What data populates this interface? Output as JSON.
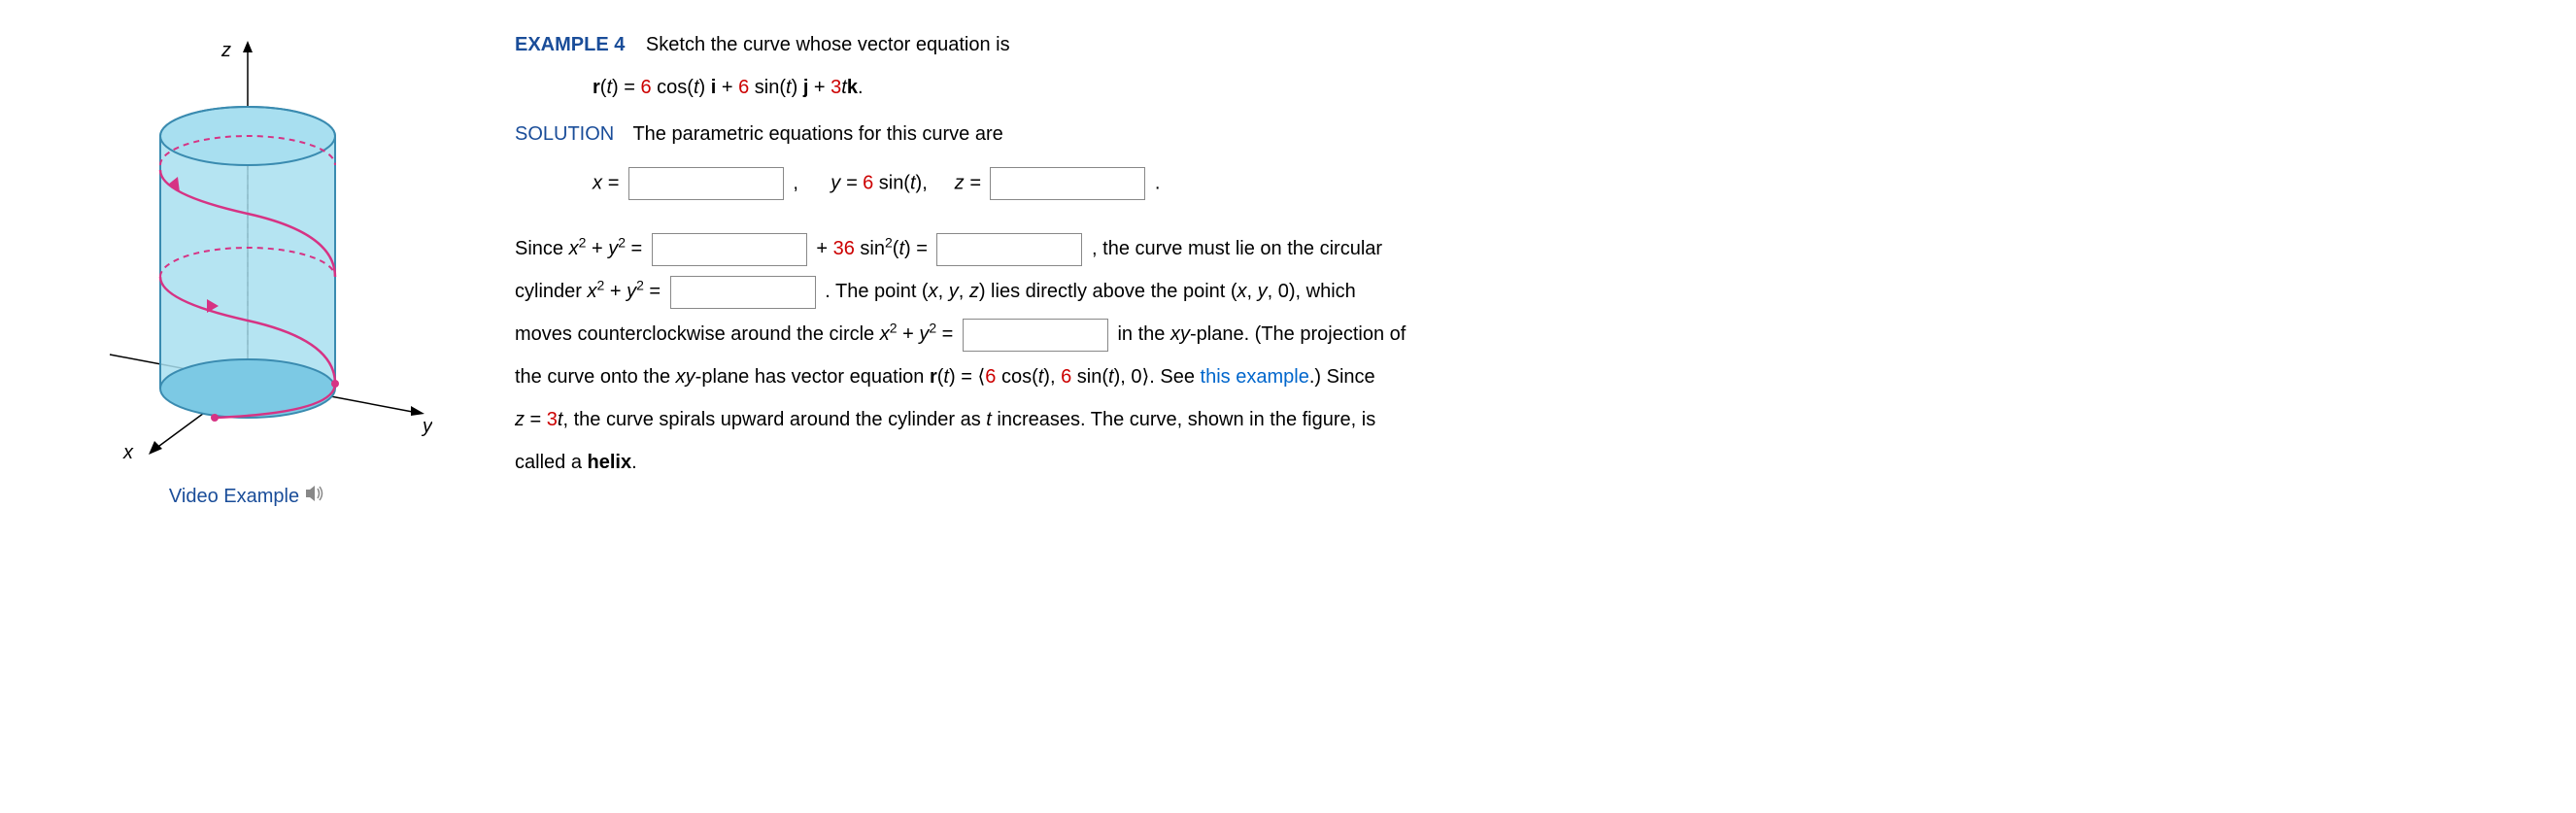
{
  "figure": {
    "z_label": "z",
    "y_label": "y",
    "x_label": "x",
    "video_link_text": "Video Example"
  },
  "example": {
    "label": "EXAMPLE 4",
    "prompt": "Sketch the curve whose vector equation is"
  },
  "equation": {
    "r_of_t": "r",
    "t": "t",
    "eq": " = ",
    "coef1": "6",
    "cos_t": " cos(",
    "close": ") ",
    "i": "i",
    "plus": " + ",
    "coef2": "6",
    "sin_t": " sin(",
    "j": "j",
    "coef3": "3",
    "k": "k",
    "period": "."
  },
  "solution": {
    "label": "SOLUTION",
    "intro": "The parametric equations for this curve are"
  },
  "param_line": {
    "x_eq": "x = ",
    "comma": ",",
    "y_eq": "y = ",
    "six": "6",
    "sin_t": " sin(",
    "t": "t",
    "close": "),",
    "z_eq": "z = ",
    "period": "."
  },
  "body": {
    "since": "Since ",
    "x2y2": "x",
    "plus": " + ",
    "y": "y",
    "eq": " = ",
    "plus36": " + ",
    "thirtysix": "36",
    "sin2t": " sin",
    "t": "t",
    "eq2": " = ",
    "circ1": ", the curve must lie on the circular",
    "cylinder": "cylinder ",
    "point1": ". The point (",
    "x_v": "x",
    "y_v": "y",
    "z_v": "z",
    "lies": ") lies directly above the point (",
    "zero": ", 0), which",
    "moves": "moves counterclockwise around the circle ",
    "inxy": " in the ",
    "xy": "xy",
    "plane": "-plane. (The projection of",
    "onto": "the curve onto the ",
    "plane2": "-plane has vector equation ",
    "r": "r",
    "eq3": " = ",
    "langle": "⟨",
    "six": "6",
    "cos": " cos(",
    "close": "), ",
    "sin": " sin(",
    "close2": "), 0",
    "rangle": "⟩",
    "see": ". See ",
    "thisex": "this example",
    "since2": ".) Since",
    "zeq3t": " = ",
    "three": "3",
    "spiral": ", the curve spirals upward around the cylinder as ",
    "inc": " increases. The curve, shown in the figure, is",
    "called": "called a ",
    "helix": "helix",
    "period": "."
  }
}
